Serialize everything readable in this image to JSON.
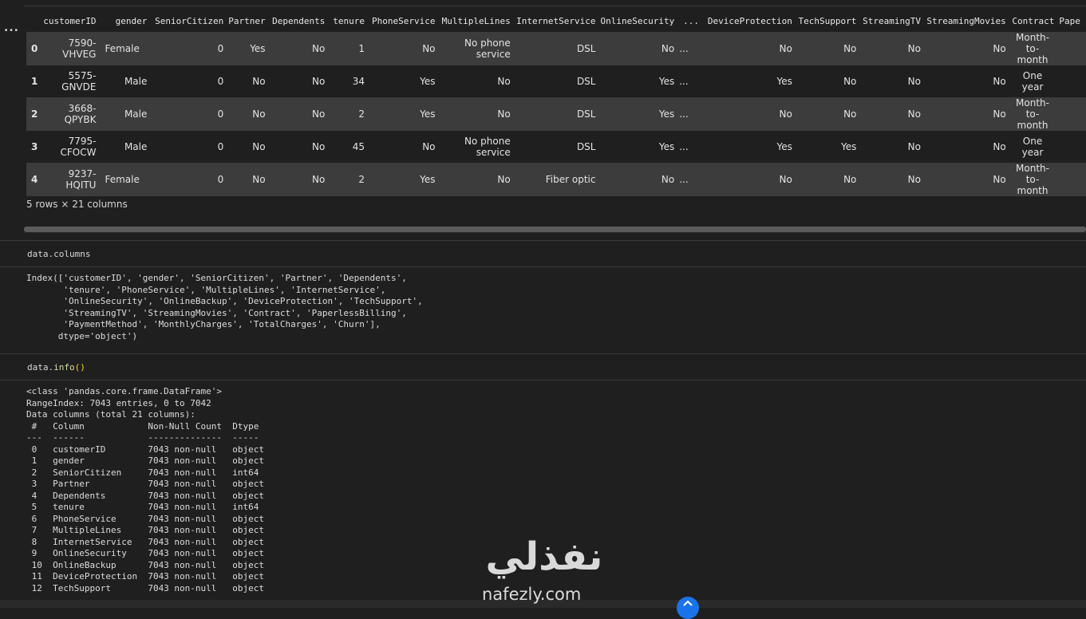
{
  "dataframe": {
    "menu_glyph": "...",
    "columns": [
      "",
      "customerID",
      "gender",
      "SeniorCitizen",
      "Partner",
      "Dependents",
      "tenure",
      "PhoneService",
      "MultipleLines",
      "InternetService",
      "OnlineSecurity",
      "...",
      "DeviceProtection",
      "TechSupport",
      "StreamingTV",
      "StreamingMovies",
      "Contract",
      "Pape"
    ],
    "rows": [
      [
        "0",
        "7590-VHVEG",
        "Female",
        "0",
        "Yes",
        "No",
        "1",
        "No",
        "No phone service",
        "DSL",
        "No",
        "...",
        "No",
        "No",
        "No",
        "No",
        "Month-to-month",
        ""
      ],
      [
        "1",
        "5575-GNVDE",
        "Male",
        "0",
        "No",
        "No",
        "34",
        "Yes",
        "No",
        "DSL",
        "Yes",
        "...",
        "Yes",
        "No",
        "No",
        "No",
        "One year",
        ""
      ],
      [
        "2",
        "3668-QPYBK",
        "Male",
        "0",
        "No",
        "No",
        "2",
        "Yes",
        "No",
        "DSL",
        "Yes",
        "...",
        "No",
        "No",
        "No",
        "No",
        "Month-to-month",
        ""
      ],
      [
        "3",
        "7795-CFOCW",
        "Male",
        "0",
        "No",
        "No",
        "45",
        "No",
        "No phone service",
        "DSL",
        "Yes",
        "...",
        "Yes",
        "Yes",
        "No",
        "No",
        "One year",
        ""
      ],
      [
        "4",
        "9237-HQITU",
        "Female",
        "0",
        "No",
        "No",
        "2",
        "Yes",
        "No",
        "Fiber optic",
        "No",
        "...",
        "No",
        "No",
        "No",
        "No",
        "Month-to-month",
        ""
      ]
    ],
    "shape": "5 rows × 21 columns"
  },
  "cell_columns": {
    "code": "data.columns",
    "output_lines": [
      "Index(['customerID', 'gender', 'SeniorCitizen', 'Partner', 'Dependents',",
      "       'tenure', 'PhoneService', 'MultipleLines', 'InternetService',",
      "       'OnlineSecurity', 'OnlineBackup', 'DeviceProtection', 'TechSupport',",
      "       'StreamingTV', 'StreamingMovies', 'Contract', 'PaperlessBilling',",
      "       'PaymentMethod', 'MonthlyCharges', 'TotalCharges', 'Churn'],",
      "      dtype='object')"
    ]
  },
  "cell_info": {
    "code_object": "data",
    "code_method": "info",
    "code_parens": "()",
    "output_lines": [
      "<class 'pandas.core.frame.DataFrame'>",
      "RangeIndex: 7043 entries, 0 to 7042",
      "Data columns (total 21 columns):",
      " #   Column            Non-Null Count  Dtype ",
      "---  ------            --------------  ----- ",
      " 0   customerID        7043 non-null   object",
      " 1   gender            7043 non-null   object",
      " 2   SeniorCitizen     7043 non-null   int64 ",
      " 3   Partner           7043 non-null   object",
      " 4   Dependents        7043 non-null   object",
      " 5   tenure            7043 non-null   int64 ",
      " 6   PhoneService      7043 non-null   object",
      " 7   MultipleLines     7043 non-null   object",
      " 8   InternetService   7043 non-null   object",
      " 9   OnlineSecurity    7043 non-null   object",
      " 10  OnlineBackup      7043 non-null   object",
      " 11  DeviceProtection  7043 non-null   object",
      " 12  TechSupport       7043 non-null   object"
    ]
  },
  "watermark": {
    "arabic": "نفذلي",
    "latin": "nafezly.com"
  },
  "colors": {
    "background": "#1f1f1f",
    "row_stripe": "#3c3c3c",
    "function_name": "#dcdcaa",
    "bracket": "#ffd700",
    "accent_badge": "#1a73e8"
  },
  "icons": {
    "output_menu": "more-horizontal-icon",
    "scroll_badge": "chevron-up-icon"
  }
}
